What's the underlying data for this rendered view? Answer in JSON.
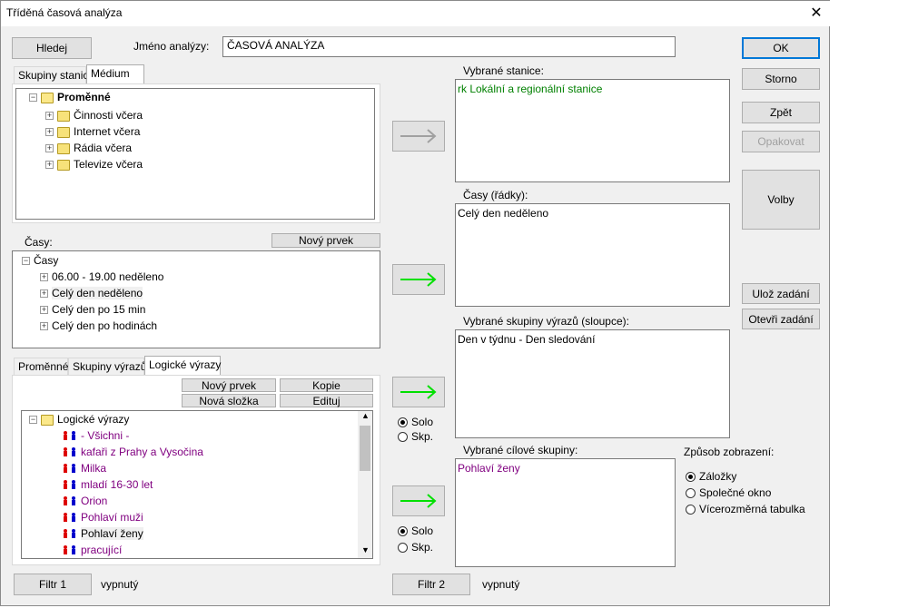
{
  "window": {
    "title": "Tříděná časová analýza"
  },
  "toolbar": {
    "search_label": "Hledej",
    "analysis_name_label": "Jméno analýzy:",
    "analysis_name_value": "ČASOVÁ ANALÝZA"
  },
  "right_buttons": {
    "ok": "OK",
    "cancel": "Storno",
    "back": "Zpět",
    "repeat": "Opakovat",
    "options": "Volby",
    "save_task": "Ulož zadání",
    "open_task": "Otevři zadání"
  },
  "top_tabs": [
    "Skupiny stanic",
    "Médium"
  ],
  "variables_tree": {
    "root": "Proměnné",
    "items": [
      "Činnosti včera",
      "Internet včera",
      "Rádia včera",
      "Televize včera"
    ]
  },
  "times": {
    "label": "Časy:",
    "new_item": "Nový prvek",
    "root": "Časy",
    "items": [
      "06.00 - 19.00 neděleno",
      "Celý den neděleno",
      "Celý den po 15 min",
      "Celý den po hodinách"
    ]
  },
  "bottom_tabs": [
    "Proměnné",
    "Skupiny výrazů",
    "Logické výrazy"
  ],
  "logic": {
    "new_item": "Nový prvek",
    "copy": "Kopie",
    "new_folder": "Nová složka",
    "edit": "Edituj",
    "root": "Logické výrazy",
    "items": [
      "- Všichni -",
      "kafaři z Prahy a Vysočina",
      "Milka",
      "mladí 16-30 let",
      "Orion",
      "Pohlaví muži",
      "Pohlaví ženy",
      "pracující"
    ]
  },
  "selected": {
    "stations_label": "Vybrané stanice:",
    "stations_value": "rk Lokální a regionální stanice",
    "times_label": "Časy (řádky):",
    "times_value": "Celý den neděleno",
    "groups_label": "Vybrané skupiny výrazů (sloupce):",
    "groups_value": "Den v týdnu - Den sledování",
    "targets_label": "Vybrané cílové skupiny:",
    "targets_value": "Pohlaví ženy"
  },
  "radios": {
    "solo": "Solo",
    "skp": "Skp."
  },
  "display": {
    "label": "Způsob zobrazení:",
    "options": [
      "Záložky",
      "Společné okno",
      "Vícerozměrná tabulka"
    ]
  },
  "filters": {
    "filter1": "Filtr 1",
    "filter1_state": "vypnutý",
    "filter2": "Filtr 2",
    "filter2_state": "vypnutý"
  },
  "colors": {
    "arrow_active": "#00e000",
    "arrow_inactive": "#a0a0a0",
    "station_text": "#008000",
    "target_text": "#800080",
    "default_button_border": "#0078d7"
  }
}
